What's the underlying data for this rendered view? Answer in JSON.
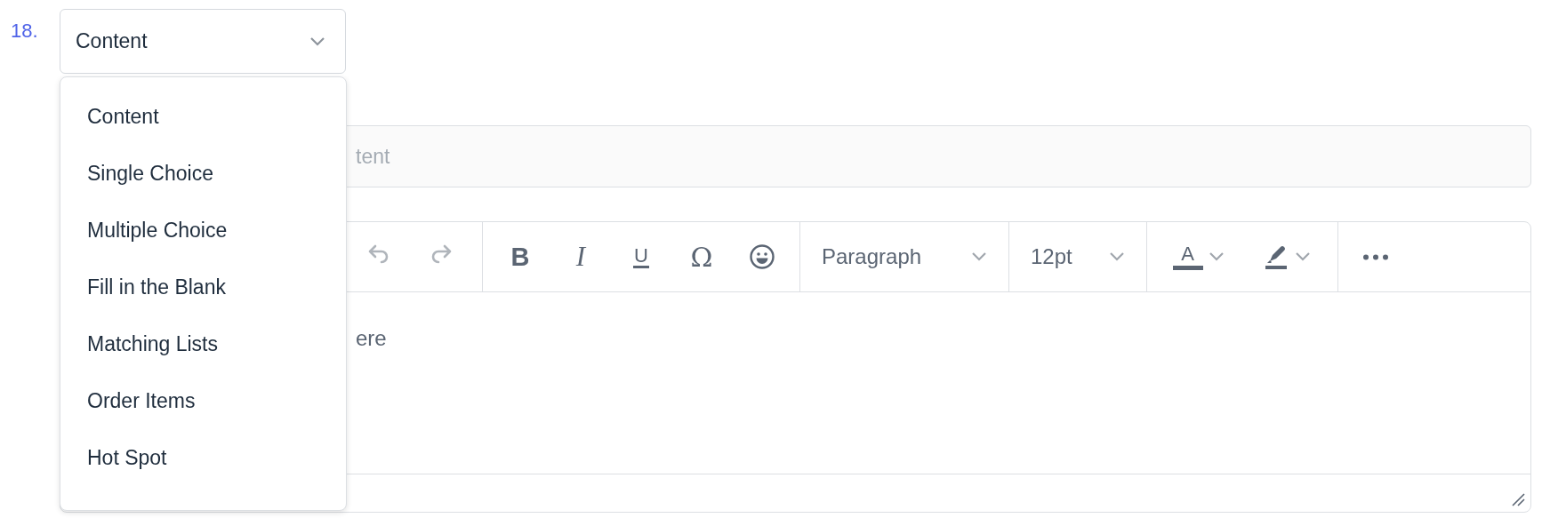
{
  "question": {
    "number": "18.",
    "type_select": {
      "value": "Content",
      "expanded": true,
      "options": [
        "Content",
        "Single Choice",
        "Multiple Choice",
        "Fill in the Blank",
        "Matching Lists",
        "Order Items",
        "Hot Spot"
      ]
    },
    "title_field": {
      "placeholder": "tent"
    },
    "editor": {
      "toolbar_groups": [
        [
          {
            "kind": "undo",
            "disabled": true
          },
          {
            "kind": "redo",
            "disabled": true
          }
        ],
        [
          {
            "kind": "bold",
            "label": "B"
          },
          {
            "kind": "italic",
            "label": "I"
          },
          {
            "kind": "underline",
            "label": "U"
          },
          {
            "kind": "char",
            "label": "Ω"
          },
          {
            "kind": "emoji"
          }
        ],
        [
          {
            "kind": "dropdown",
            "label": "Paragraph"
          }
        ],
        [
          {
            "kind": "dropdown",
            "label": "12pt"
          }
        ],
        [
          {
            "kind": "textcolor",
            "label": "A"
          },
          {
            "kind": "highlight"
          }
        ],
        [
          {
            "kind": "more"
          }
        ]
      ],
      "body_text": "ere"
    }
  }
}
